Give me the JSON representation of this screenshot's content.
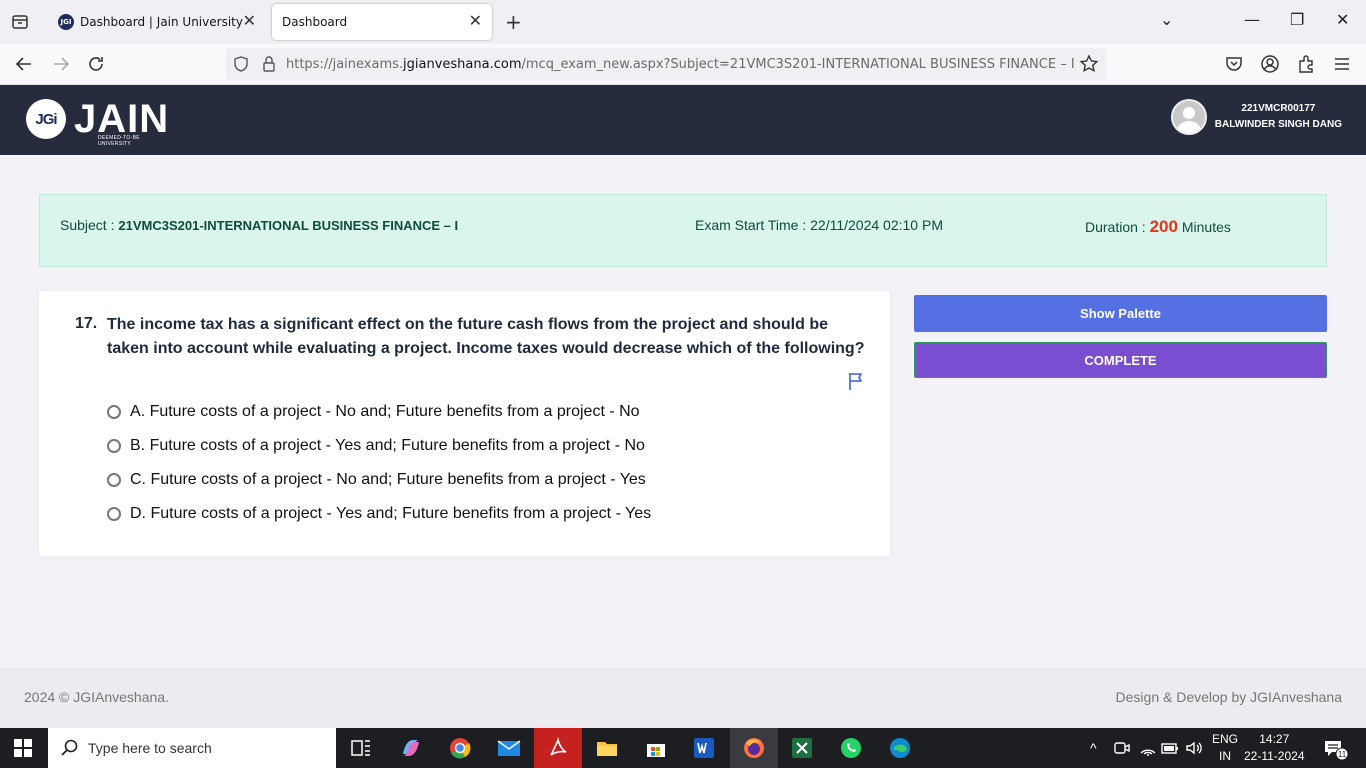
{
  "browser": {
    "tabs": [
      {
        "label": "Dashboard | Jain University",
        "favicon": "JGI"
      },
      {
        "label": "Dashboard"
      }
    ],
    "url": {
      "prefix": "https://jainexams.",
      "domain": "jgianveshana.com",
      "path": "/mcq_exam_new.aspx?Subject=21VMC3S201-INTERNATIONAL BUSINESS FINANCE – I"
    }
  },
  "header": {
    "logo_badge": "JGi",
    "logo_text": "JAIN",
    "logo_sub": "DEEMED-TO-BE UNIVERSITY",
    "user_id": "221VMCR00177",
    "user_name": "BALWINDER SINGH DANG"
  },
  "exam": {
    "subject_label": "Subject : ",
    "subject_value": "21VMC3S201-INTERNATIONAL BUSINESS FINANCE – I",
    "start_label": "Exam Start Time : ",
    "start_value": "22/11/2024 02:10 PM",
    "duration_label": "Duration : ",
    "duration_value": "200",
    "duration_unit": " Minutes"
  },
  "question": {
    "number": "17.",
    "text": "The income tax has a significant effect on the future cash flows from the project and should be taken into account while evaluating a project. Income taxes would decrease which of the following?",
    "options": [
      "A. Future costs of a project - No and; Future benefits from a project - No",
      "B. Future costs of a project - Yes and; Future benefits from a project - No",
      "C. Future costs of a project - No and; Future benefits from a project - Yes",
      "D. Future costs of a project - Yes and; Future benefits from a project - Yes"
    ]
  },
  "actions": {
    "palette_label": "Show Palette",
    "complete_label": "COMPLETE"
  },
  "footer": {
    "left": "2024 © JGIAnveshana.",
    "right": "Design & Develop by JGIAnveshana"
  },
  "taskbar": {
    "search_placeholder": "Type here to search",
    "lang_top": "ENG",
    "lang_bottom": "IN",
    "time": "14:27",
    "date": "22-11-2024",
    "notif_count": "11"
  },
  "colors": {
    "header_bg": "#262b3e",
    "palette_btn": "#5570e3",
    "complete_btn": "#7a4ed0",
    "duration_accent": "#e8331a",
    "info_bg": "#d9f5ec"
  }
}
